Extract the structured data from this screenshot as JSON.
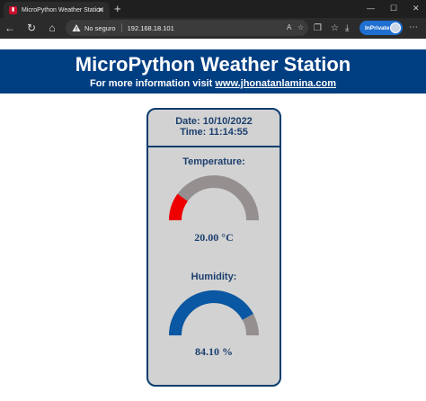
{
  "browser": {
    "tab_title": "MicroPython Weather Station",
    "tab_close_icon": "close-icon",
    "new_tab_icon": "plus-icon",
    "security_label": "No seguro",
    "url": "192.168.18.101",
    "inprivate_label": "InPrivate"
  },
  "header": {
    "title": "MicroPython Weather Station",
    "subtitle_prefix": "For more information visit ",
    "link_text": "www.jhonatanlamina.com"
  },
  "station": {
    "date_line": "Date: 10/10/2022",
    "time_line": "Time: 11:14:55",
    "temperature": {
      "label": "Temperature:",
      "value_text": "20.00 °C",
      "gauge_fraction": 0.2,
      "fill_color": "#ee0000",
      "track_color": "#958f8f"
    },
    "humidity": {
      "label": "Humidity:",
      "value_text": "84.10 %",
      "gauge_fraction": 0.841,
      "fill_color": "#0a57a3",
      "track_color": "#958f8f"
    }
  },
  "colors": {
    "banner_bg": "#003e82",
    "card_bg": "#d2d2d2",
    "card_border": "#0a3d6e",
    "text_dark_blue": "#1c3f6e"
  }
}
